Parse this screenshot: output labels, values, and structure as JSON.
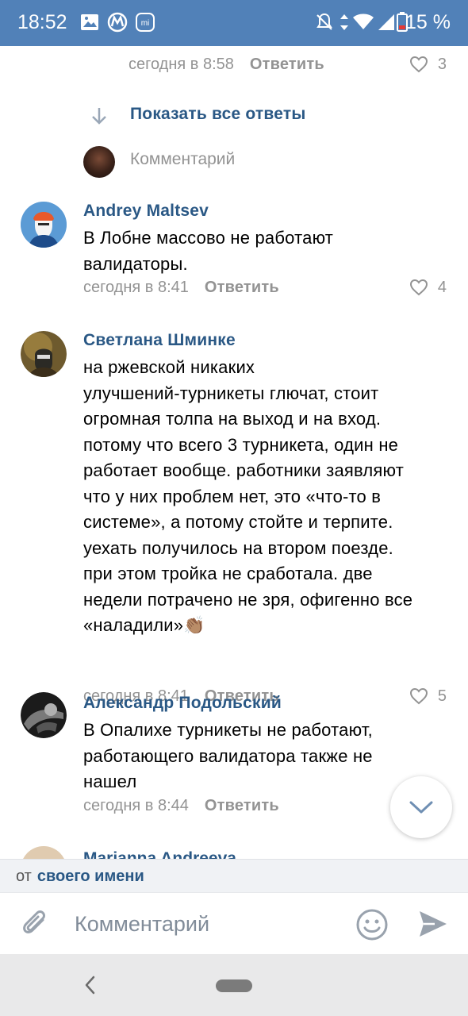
{
  "status_bar": {
    "time": "18:52",
    "battery": "15 %",
    "icons": [
      "image-icon",
      "metro-icon",
      "mi-icon",
      "notifications-off-icon",
      "data-arrows-icon",
      "wifi-icon",
      "signal-icon",
      "battery-low-icon"
    ],
    "bg_color": "#5181b8"
  },
  "feed": {
    "prev_meta": {
      "date": "сегодня в 8:58",
      "reply": "Ответить",
      "likes": "3"
    },
    "show_all": "Показать все ответы",
    "reply_placeholder": "Комментарий",
    "comments": [
      {
        "author": "Andrey Maltsev",
        "lines": [
          "В Лобне массово не работают",
          "валидаторы."
        ],
        "date": "сегодня в 8:41",
        "reply": "Ответить",
        "likes": "4"
      },
      {
        "author": "Светлана Шминке",
        "lines": [
          "на ржевской никаких",
          "улучшений-турникеты глючат, стоит",
          "огромная толпа на выход и на вход.",
          "потому что всего 3 турникета, один не",
          "работает вообще. работники  заявляют",
          "что у них проблем нет, это «что-то в",
          "системе», а потому стойте и терпите.",
          "уехать получилось на втором поезде.",
          "при этом тройка не сработала. две",
          "недели потрачено не зря, офигенно все",
          "«наладили»"
        ],
        "emoji": "👏🏽",
        "date": "сегодня в 8:41",
        "reply": "Ответить",
        "likes": "5"
      },
      {
        "author": "Александр Подольский",
        "lines": [
          "В Опалихе турникеты не работают,",
          "работающего  валидатора  также не",
          "нашел"
        ],
        "date": "сегодня в 8:44",
        "reply": "Ответить",
        "likes": ""
      }
    ],
    "partial_author": "Marianna Andreeva"
  },
  "composer": {
    "from_prefix": "от",
    "from_link": "своего имени",
    "placeholder": "Комментарий"
  },
  "colors": {
    "link": "#2a5885",
    "meta": "#939393"
  }
}
